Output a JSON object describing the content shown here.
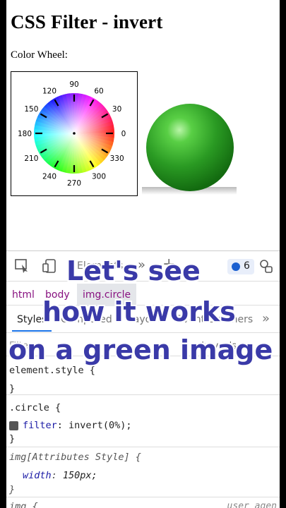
{
  "page": {
    "title": "CSS Filter - invert",
    "wheel_label": "Color Wheel:",
    "wheel_degrees": [
      "90",
      "60",
      "30",
      "0",
      "330",
      "300",
      "270",
      "240",
      "210",
      "180",
      "150",
      "120"
    ]
  },
  "devtools": {
    "elements_tab": "Elements",
    "more_tabs": "»",
    "add_tab": "+",
    "issues_count": "6",
    "breadcrumb": [
      "html",
      "body",
      "img.circle"
    ],
    "subtabs": [
      "Styles",
      "Computed",
      "Layout",
      "Event Listeners"
    ],
    "subtab_more": "»",
    "filter_placeholder": "Filter",
    "filter_hov": ":hov .cls",
    "rules": {
      "element_style_selector": "element.style {",
      "element_style_close": "}",
      "circle_selector": ".circle {",
      "circle_prop": "filter",
      "circle_value": "invert(0%);",
      "circle_close": "}",
      "attr_selector": "img[Attributes Style] {",
      "attr_prop": "width",
      "attr_value": "150px;",
      "attr_close": "}",
      "img_selector": "img {",
      "img_source": "user agen"
    }
  },
  "caption": {
    "line1": "Let's see",
    "line2": "how it works",
    "line3": "on a green image"
  },
  "colors": {
    "caption": "#3a3aa8",
    "sphere": "#2e9e2a",
    "badge": "#1a5fd0"
  }
}
